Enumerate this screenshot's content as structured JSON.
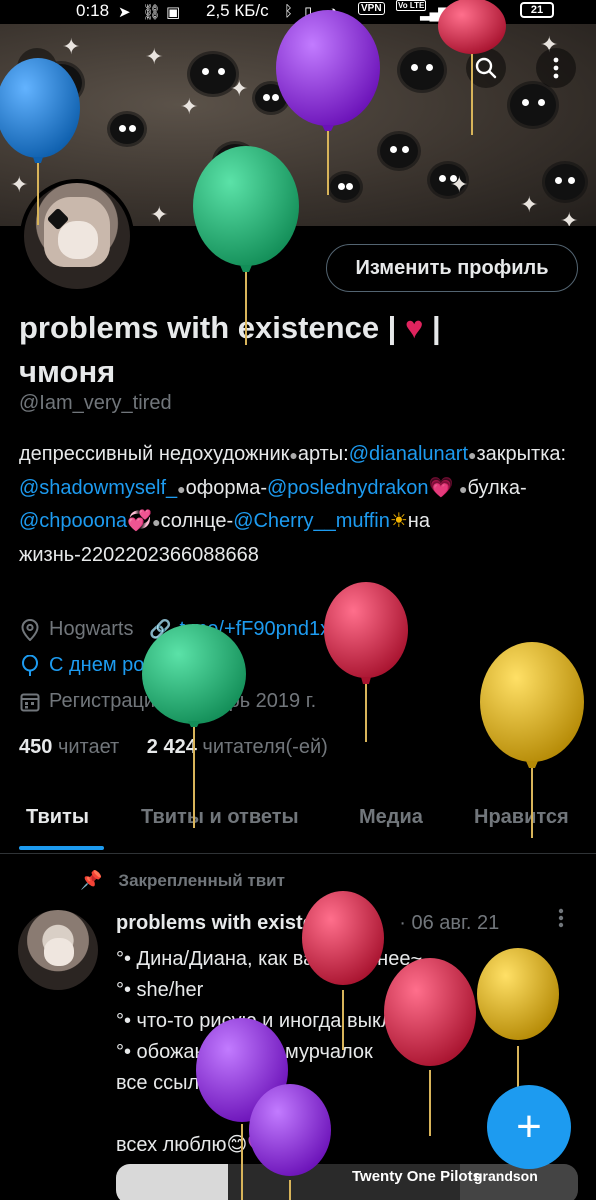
{
  "status_bar": {
    "time": "0:18",
    "net_speed": "2,5 КБ/с",
    "vpn": "VPN",
    "volte": "Vo LTE",
    "battery": "21",
    "icons": [
      "telegram-icon",
      "link-icon",
      "bluetooth-icon",
      "mute-icon",
      "alarm-icon",
      "signal-icon",
      "wifi-icon",
      "battery-icon"
    ]
  },
  "header": {
    "back_icon": "‹",
    "search_icon": "search-icon",
    "more_icon": "more-vertical-icon"
  },
  "profile": {
    "edit_button": "Изменить профиль",
    "name_line1": "problems with existence | ",
    "name_heart": "♥",
    "name_line1_end": " |",
    "name_line2": "чмоня",
    "handle": "@Iam_very_tired",
    "bio": {
      "p1": "депрессивный недохудожник",
      "sep": "●",
      "p2": "арты:",
      "l1": "@dianalunart",
      "p3": "закрытка:",
      "l2": "@shadowmyself_",
      "p4": "оформа-",
      "l3": "@poslednydrakon",
      "e1": "💗",
      "p5": "булка-",
      "l4": "@chpooona",
      "e2": "💞",
      "p6": "солнце-",
      "l5": "@Cherry__muffin",
      "e3": "☀",
      "p7": "на жизнь-2202202366088668"
    },
    "location": "Hogwarts",
    "website": "t.me/+fF90pnd1xXUyZ...",
    "birthday": "С днем рождения!",
    "joined": "Регистрация: октябрь 2019 г.",
    "following_count": "450",
    "following_label": "читает",
    "followers_count": "2 424",
    "followers_label": "читателя(-ей)"
  },
  "tabs": [
    "Твиты",
    "Твиты и ответы",
    "Медиа",
    "Нравится"
  ],
  "pinned_tweet": {
    "pinned_label": "Закрепленный твит",
    "author": "problems with existence | ...",
    "date": "· 06 авг. 21",
    "lines": [
      "°• Дина/Диана, как вам удобнее~",
      "°• she/her",
      "°• что-то рисую и иногда выкладываю",
      "°• обожаю кофе и мурчалок",
      "все ссылки ниже ↓",
      "",
      "всех люблю😊💜"
    ],
    "media_label_1": "Twenty One Pilots",
    "media_label_2": "grandson"
  },
  "fab_label": "+",
  "colors": {
    "accent": "#1d9bf0",
    "balloon_purple": "#8a2be2",
    "balloon_green": "#22b573",
    "balloon_red": "#d6234a",
    "balloon_blue": "#1e7fd6",
    "balloon_yellow": "#d9ad17"
  }
}
